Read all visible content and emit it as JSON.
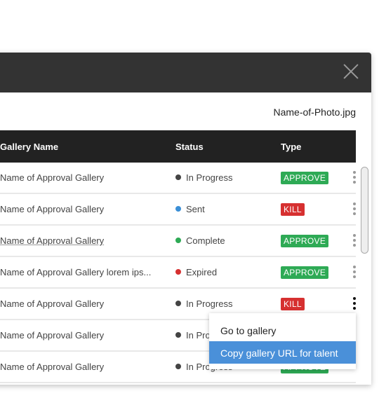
{
  "modal": {
    "file_name": "Name-of-Photo.jpg"
  },
  "table": {
    "headers": [
      "Gallery Name",
      "Status",
      "Type"
    ],
    "rows": [
      {
        "name": "Name of Approval Gallery",
        "status": "In Progress",
        "status_color": "#444444",
        "type": "APPROVE"
      },
      {
        "name": "Name of Approval Gallery",
        "status": "Sent",
        "status_color": "#3b8fd6",
        "type": "KILL"
      },
      {
        "name": "Name of Approval Gallery",
        "status": "Complete",
        "status_color": "#2eaa55",
        "type": "APPROVE"
      },
      {
        "name": "Name of Approval Gallery lorem ips...",
        "status": "Expired",
        "status_color": "#d63030",
        "type": "APPROVE"
      },
      {
        "name": "Name of Approval Gallery",
        "status": "In Progress",
        "status_color": "#444444",
        "type": "KILL"
      },
      {
        "name": "Name of Approval Gallery",
        "status": "In Progress",
        "status_color": "#444444",
        "type": ""
      },
      {
        "name": "Name of Approval Gallery",
        "status": "In Progress",
        "status_color": "#444444",
        "type": "APPROVE"
      }
    ]
  },
  "colors": {
    "approve": "#2eaa55",
    "kill": "#d63030",
    "header": "#333333",
    "highlight": "#4a90d9"
  },
  "context_menu": {
    "items": [
      "Go to gallery",
      "Copy gallery URL for talent"
    ]
  }
}
